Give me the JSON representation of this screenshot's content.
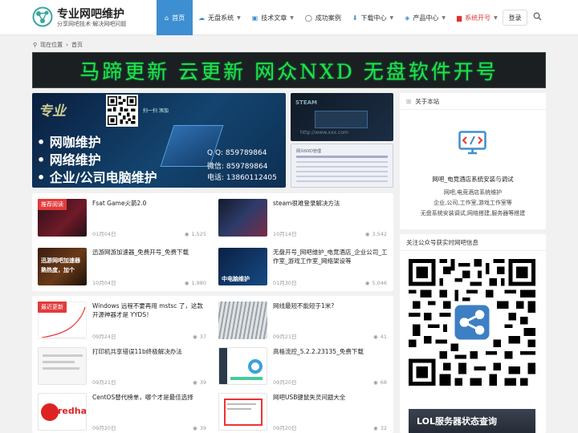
{
  "brand": {
    "title": "专业网吧维护",
    "subtitle": "分享网吧技术·解决网吧问题"
  },
  "nav": [
    {
      "label": "首页",
      "icon": "home-icon",
      "active": true
    },
    {
      "label": "无盘系统",
      "icon": "cloud-icon",
      "caret": true
    },
    {
      "label": "技术文章",
      "icon": "book-icon",
      "caret": true
    },
    {
      "label": "成功案例",
      "icon": "chat-icon"
    },
    {
      "label": "下载中心",
      "icon": "download-icon",
      "caret": true
    },
    {
      "label": "产品中心",
      "icon": "cube-icon",
      "caret": true
    },
    {
      "label": "系统开号",
      "icon": "monitor-icon",
      "caret": true,
      "accent": "#dd3333"
    }
  ],
  "header": {
    "login_label": "登录",
    "search_icon": "search-icon"
  },
  "breadcrumb": {
    "prefix": "现在位置",
    "current": "首页"
  },
  "banner_text": "马蹄更新 云更新 网众NXD 无盘软件开号",
  "hero": {
    "logo_text": "专业",
    "qr_caption": "扫一扫 添加",
    "lines": [
      "• 网咖维护",
      "• 网络维护",
      "• 企业/公司电脑维护"
    ],
    "contacts": [
      "Q Q: 859789864",
      "微信: 859789864",
      "电话: 13860112405"
    ]
  },
  "side_thumbs": [
    {
      "label": "STEAM",
      "watermark": "http://www.xxx.com"
    },
    {
      "label": "网众NXD管理"
    }
  ],
  "grid1": {
    "tag": "推荐阅读",
    "posts": [
      {
        "title": "Fsat Game火箭2.0",
        "date": "01月04日",
        "views": "1,525"
      },
      {
        "title": "steam很难登录解决方法",
        "date": "10月14日",
        "views": "3,542"
      },
      {
        "title": "迅游网游加速器_免费开号_免费下载",
        "date": "10月04日",
        "views": "1,980",
        "thumb_text": "迅游网吧加速器 熟热度，加个"
      },
      {
        "title": "无盘开号_网吧维护_电竞酒店_企业公司_工作室_游戏工作室_网络架设等",
        "date": "01月30日",
        "views": "5,046",
        "thumb_text": "中电脑维护"
      }
    ]
  },
  "grid2": {
    "tag": "最近更新",
    "posts": [
      {
        "title": "Windows 远程不要再用 mstsc 了，这款开源神器才是 YYDS！",
        "date": "09月24日",
        "views": "37"
      },
      {
        "title": "网线最短不能短于1米?",
        "date": "09月21日",
        "views": "41"
      },
      {
        "title": "打印机共享错误11b终极解决办法",
        "date": "09月21日",
        "views": "39"
      },
      {
        "title": "高格流控_5.2.2.23135_免费下载",
        "date": "09月20日",
        "views": "68"
      },
      {
        "title": "CentOS替代榜单，哪个才是最佳选择",
        "date": "09月20日",
        "views": "39",
        "thumb_text": "redha"
      },
      {
        "title": "网吧USB键鼠失灵问题大全",
        "date": "09月20日",
        "views": "32"
      }
    ]
  },
  "about": {
    "title": "关于本站",
    "heading": "网吧_电竞酒店系统安装与调试",
    "lines": [
      "网吧,电竞酒店系统维护",
      "企业,公司,工作室,游戏工作室等",
      "无盘系统安装调试,网络搭建,服务器等搭建"
    ]
  },
  "wechat": {
    "title": "关注公众号获实时网吧信息",
    "promo_text": "LOL服务器状态查询"
  },
  "colors": {
    "accent": "#3d8fd1",
    "tag_red": "#e23b3b",
    "banner_green": "#22e04a"
  }
}
